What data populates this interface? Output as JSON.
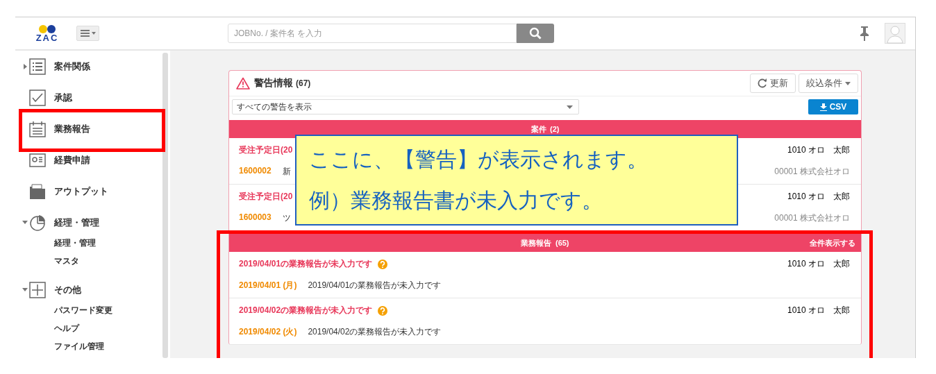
{
  "header": {
    "logo": "ZAC",
    "search": {
      "placeholder": "JOBNo. / 案件名 を入力"
    }
  },
  "sidebar": {
    "items": [
      {
        "label": "案件関係",
        "expanded": false
      },
      {
        "label": "承認"
      },
      {
        "label": "業務報告"
      },
      {
        "label": "経費申請"
      },
      {
        "label": "アウトプット"
      },
      {
        "label": "経理・管理",
        "expanded": true,
        "children": [
          {
            "label": "経理・管理"
          },
          {
            "label": "マスタ"
          }
        ]
      },
      {
        "label": "その他",
        "expanded": true,
        "children": [
          {
            "label": "パスワード変更"
          },
          {
            "label": "ヘルプ"
          },
          {
            "label": "ファイル管理"
          }
        ]
      }
    ]
  },
  "alerts": {
    "title": "警告情報",
    "count": "(67)",
    "refresh": "更新",
    "filter": "絞込条件",
    "select": "すべての警告を表示",
    "csv": "CSV",
    "sections": [
      {
        "title": "案件",
        "count": "(2)",
        "rows": [
          {
            "title": "受注予定日(20",
            "code": "1600002",
            "description": "新",
            "person": "1010 オロ　太郎",
            "company": "00001 株式会社オロ"
          },
          {
            "title": "受注予定日(20",
            "code": "1600003",
            "description": "ツ",
            "person": "1010 オロ　太郎",
            "company": "00001 株式会社オロ"
          }
        ]
      },
      {
        "title": "業務報告",
        "count": "(65)",
        "link": "全件表示する",
        "rows": [
          {
            "title": "2019/04/01の業務報告が未入力です",
            "help": true,
            "code": "2019/04/01 (月)",
            "description": "2019/04/01の業務報告が未入力です",
            "person": "1010 オロ　太郎"
          },
          {
            "title": "2019/04/02の業務報告が未入力です",
            "help": true,
            "code": "2019/04/02 (火)",
            "description": "2019/04/02の業務報告が未入力です",
            "person": "1010 オロ　太郎"
          }
        ]
      }
    ]
  },
  "callout": {
    "lines": [
      "ここに、【警告】が表示されます。",
      "例）業務報告書が未入力です。"
    ]
  }
}
